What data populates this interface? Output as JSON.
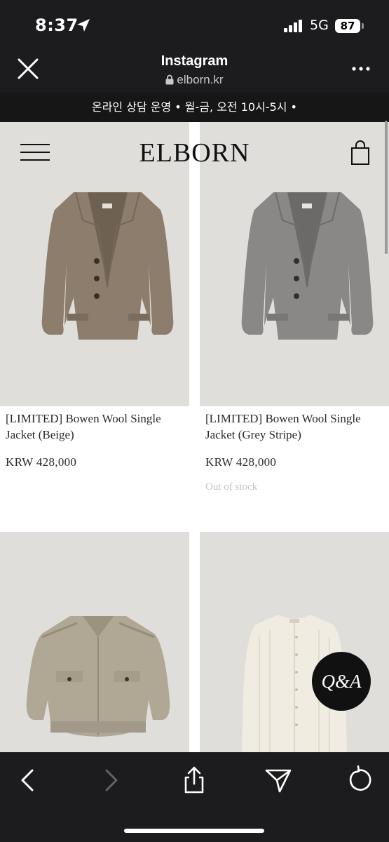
{
  "status_bar": {
    "time": "8:37",
    "network": "5G",
    "battery": "87"
  },
  "browser": {
    "title": "Instagram",
    "url": "elborn.kr"
  },
  "site": {
    "announcement": "온라인 상담 운영 • 월-금, 오전 10시-5시 •",
    "logo": "ELBORN",
    "qa_label": "Q&A"
  },
  "products": [
    {
      "title": "[LIMITED] Bowen Wool Single Jacket (Beige)",
      "price": "KRW 428,000",
      "stock": ""
    },
    {
      "title": "[LIMITED] Bowen Wool Single Jacket (Grey Stripe)",
      "price": "KRW 428,000",
      "stock": "Out of stock"
    },
    {
      "title": "",
      "price": "",
      "stock": ""
    },
    {
      "title": "",
      "price": "",
      "stock": ""
    }
  ],
  "colors": {
    "beige_jacket": "#8d7d6c",
    "grey_jacket": "#8a8886",
    "khaki_jacket": "#b0a795",
    "cream_cardigan": "#f1ece2"
  },
  "icons": [
    "close-icon",
    "lock-icon",
    "more-icon",
    "menu-icon",
    "cart-icon",
    "back-icon",
    "forward-icon",
    "share-icon",
    "send-icon",
    "reload-icon"
  ]
}
